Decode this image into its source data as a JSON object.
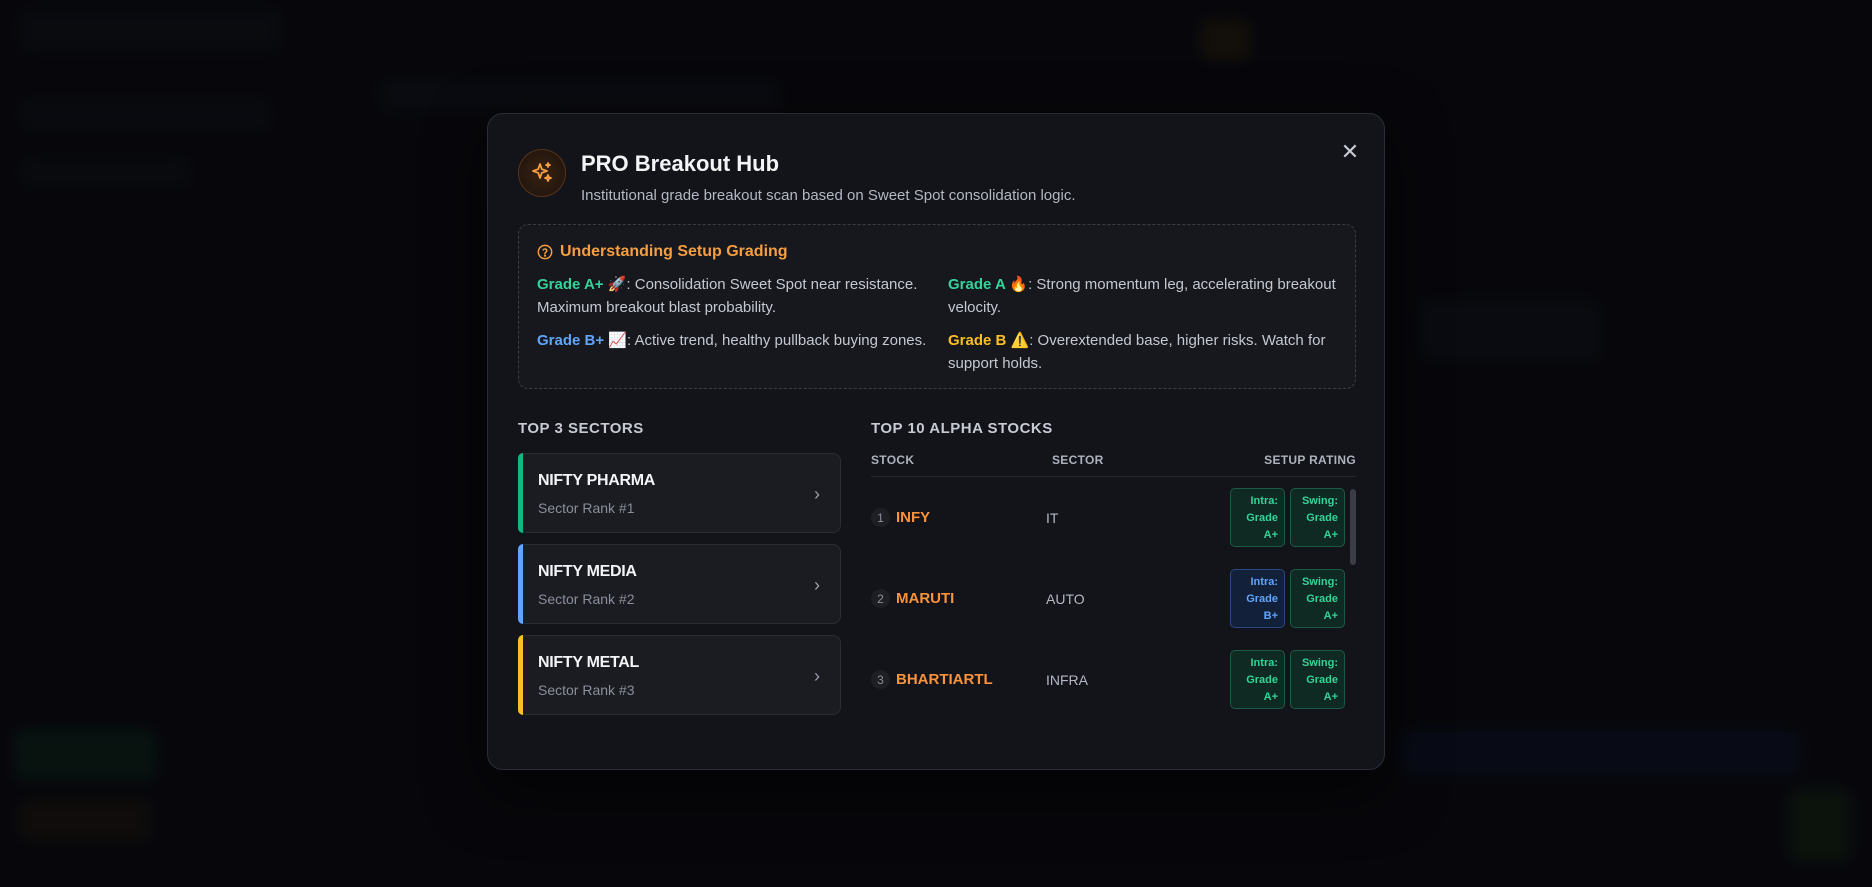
{
  "modal": {
    "title": "PRO Breakout Hub",
    "subtitle": "Institutional grade breakout scan based on Sweet Spot consolidation logic.",
    "close_label": "✕"
  },
  "grading": {
    "title": "Understanding Setup Grading",
    "items": [
      {
        "label": "Grade A+ 🚀",
        "text": ": Consolidation Sweet Spot near resistance. Maximum breakout blast probability.",
        "color": "#34d399"
      },
      {
        "label": "Grade A 🔥",
        "text": ": Strong momentum leg, accelerating breakout velocity.",
        "color": "#34d399"
      },
      {
        "label": "Grade B+ 📈",
        "text": ": Active trend, healthy pullback buying zones.",
        "color": "#60a5fa"
      },
      {
        "label": "Grade B ⚠️",
        "text": ": Overextended base, higher risks. Watch for support holds.",
        "color": "#fbbf24"
      }
    ]
  },
  "sectors": {
    "title": "TOP 3 SECTORS",
    "items": [
      {
        "name": "NIFTY PHARMA",
        "rank": "Sector Rank #1",
        "color": "#10b981"
      },
      {
        "name": "NIFTY MEDIA",
        "rank": "Sector Rank #2",
        "color": "#60a5fa"
      },
      {
        "name": "NIFTY METAL",
        "rank": "Sector Rank #3",
        "color": "#fbbf24"
      }
    ]
  },
  "stocks": {
    "title": "TOP 10 ALPHA STOCKS",
    "columns": [
      "STOCK",
      "SECTOR",
      "SETUP RATING"
    ],
    "rows": [
      {
        "rank": "1",
        "ticker": "INFY",
        "sector": "IT",
        "intra": [
          "Intra:",
          "Grade",
          "A+"
        ],
        "intra_color": "green",
        "swing": [
          "Swing:",
          "Grade",
          "A+"
        ],
        "swing_color": "green"
      },
      {
        "rank": "2",
        "ticker": "MARUTI",
        "sector": "AUTO",
        "intra": [
          "Intra:",
          "Grade",
          "B+"
        ],
        "intra_color": "blue",
        "swing": [
          "Swing:",
          "Grade",
          "A+"
        ],
        "swing_color": "green"
      },
      {
        "rank": "3",
        "ticker": "BHARTIARTL",
        "sector": "INFRA",
        "intra": [
          "Intra:",
          "Grade",
          "A+"
        ],
        "intra_color": "green",
        "swing": [
          "Swing:",
          "Grade",
          "A+"
        ],
        "swing_color": "green"
      }
    ]
  }
}
